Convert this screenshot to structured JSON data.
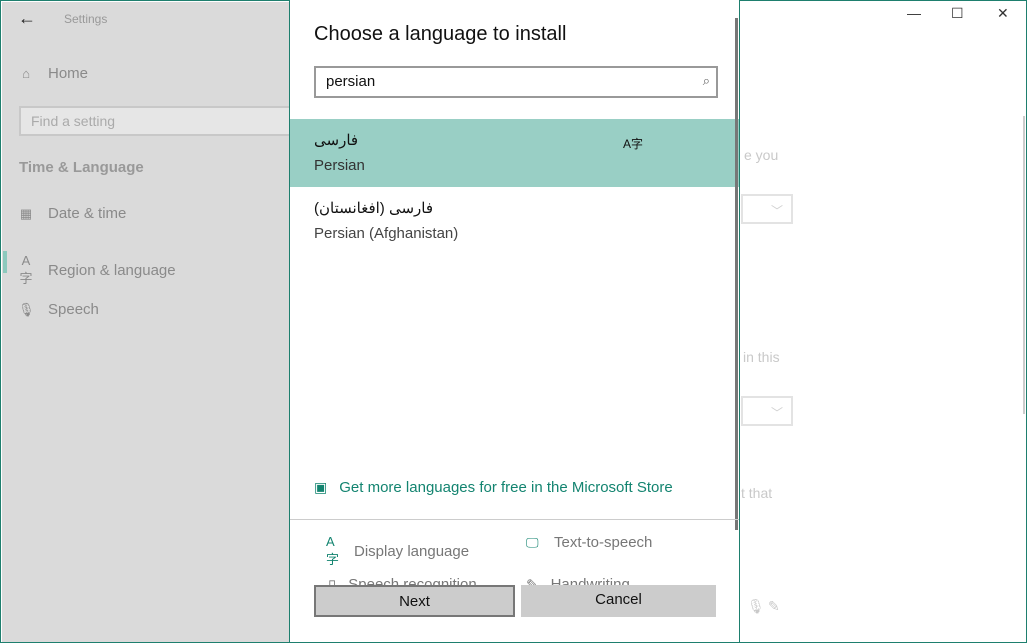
{
  "window": {
    "title": "Settings",
    "controls": {
      "minimize": "—",
      "maximize": "☐",
      "close": "✕"
    }
  },
  "sidebar": {
    "back_icon": "←",
    "home": "Home",
    "search_placeholder": "Find a setting",
    "section": "Time & Language",
    "items": [
      {
        "label": "Date & time",
        "icon": "calendar-icon"
      },
      {
        "label": "Region & language",
        "icon": "language-icon",
        "selected": true
      },
      {
        "label": "Speech",
        "icon": "microphone-icon"
      }
    ]
  },
  "background": {
    "texts": [
      "e you",
      "in this",
      "t that"
    ]
  },
  "dialog": {
    "title": "Choose a language to install",
    "search_value": "persian",
    "results": [
      {
        "native": "فارسی",
        "english": "Persian",
        "selected": true,
        "feature_icon": "display-language-icon"
      },
      {
        "native": "فارسی (افغانستان)",
        "english": "Persian (Afghanistan)"
      }
    ],
    "store_link": "Get more languages for free in the Microsoft Store",
    "features": [
      {
        "label": "Display language",
        "icon": "display-language-icon"
      },
      {
        "label": "Text-to-speech",
        "icon": "text-to-speech-icon"
      },
      {
        "label": "Speech recognition",
        "icon": "microphone-icon"
      },
      {
        "label": "Handwriting",
        "icon": "handwriting-icon"
      }
    ],
    "next": "Next",
    "cancel": "Cancel"
  },
  "colors": {
    "accent": "#138470",
    "selection": "#99cfc5",
    "border": "#1e7f6e"
  }
}
